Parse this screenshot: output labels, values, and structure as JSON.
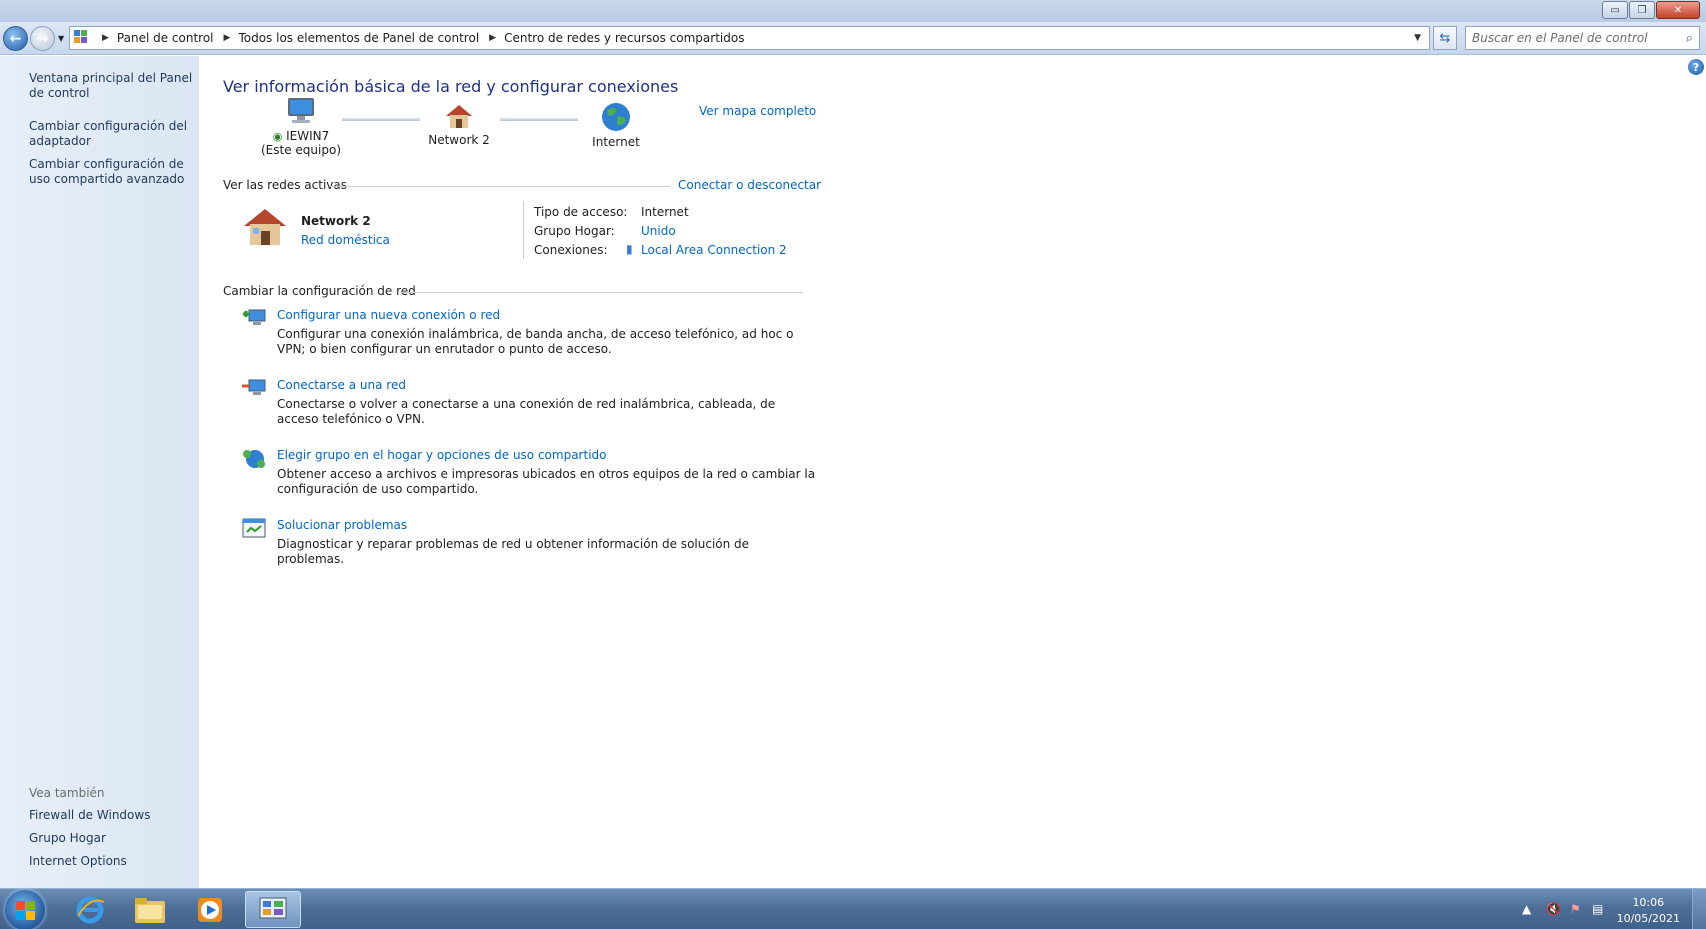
{
  "window": {
    "controls": {
      "minimize": "▭",
      "maximize": "❐",
      "close": "✕"
    }
  },
  "navbar": {
    "back_icon": "back-arrow-icon",
    "forward_icon": "forward-arrow-icon",
    "breadcrumbs": [
      "Panel de control",
      "Todos los elementos de Panel de control",
      "Centro de redes y recursos compartidos"
    ],
    "search_placeholder": "Buscar en el Panel de control"
  },
  "sidebar": {
    "links": [
      "Ventana principal del Panel de control",
      "Cambiar configuración del adaptador",
      "Cambiar configuración de uso compartido avanzado"
    ],
    "see_also_label": "Vea también",
    "see_also": [
      "Firewall de Windows",
      "Grupo Hogar",
      "Internet Options"
    ]
  },
  "main": {
    "heading": "Ver información básica de la red y configurar conexiones",
    "full_map_link": "Ver mapa completo",
    "map": {
      "computer_name": "IEWIN7",
      "computer_sub": "(Este equipo)",
      "network_name": "Network  2",
      "internet": "Internet"
    },
    "active_networks": {
      "label": "Ver las redes activas",
      "connect_link": "Conectar o desconectar",
      "network_name": "Network  2",
      "network_type": "Red doméstica",
      "access_type_label": "Tipo de acceso:",
      "access_type_value": "Internet",
      "homegroup_label": "Grupo Hogar:",
      "homegroup_value": "Unido",
      "connections_label": "Conexiones:",
      "connections_value": "Local Area Connection 2"
    },
    "change_settings": {
      "label": "Cambiar la configuración de red",
      "tasks": [
        {
          "title": "Configurar una nueva conexión o red",
          "desc": "Configurar una conexión inalámbrica, de banda ancha, de acceso telefónico, ad hoc o VPN; o bien configurar un enrutador o punto de acceso."
        },
        {
          "title": "Conectarse a una red",
          "desc": "Conectarse o volver a conectarse a una conexión de red inalámbrica, cableada, de acceso telefónico o VPN."
        },
        {
          "title": "Elegir grupo en el hogar y opciones de uso compartido",
          "desc": "Obtener acceso a archivos e impresoras ubicados en otros equipos de la red o cambiar la configuración de uso compartido."
        },
        {
          "title": "Solucionar problemas",
          "desc": "Diagnosticar y reparar problemas de red u obtener información de solución de problemas."
        }
      ]
    }
  },
  "taskbar": {
    "time": "10:06",
    "date": "10/05/2021",
    "apps": [
      "internet-explorer-icon",
      "folder-icon",
      "media-player-icon",
      "control-panel-icon"
    ]
  },
  "colors": {
    "link": "#0066cc",
    "heading": "#1e3287",
    "sidebar_bg": "#e3ebf6"
  }
}
